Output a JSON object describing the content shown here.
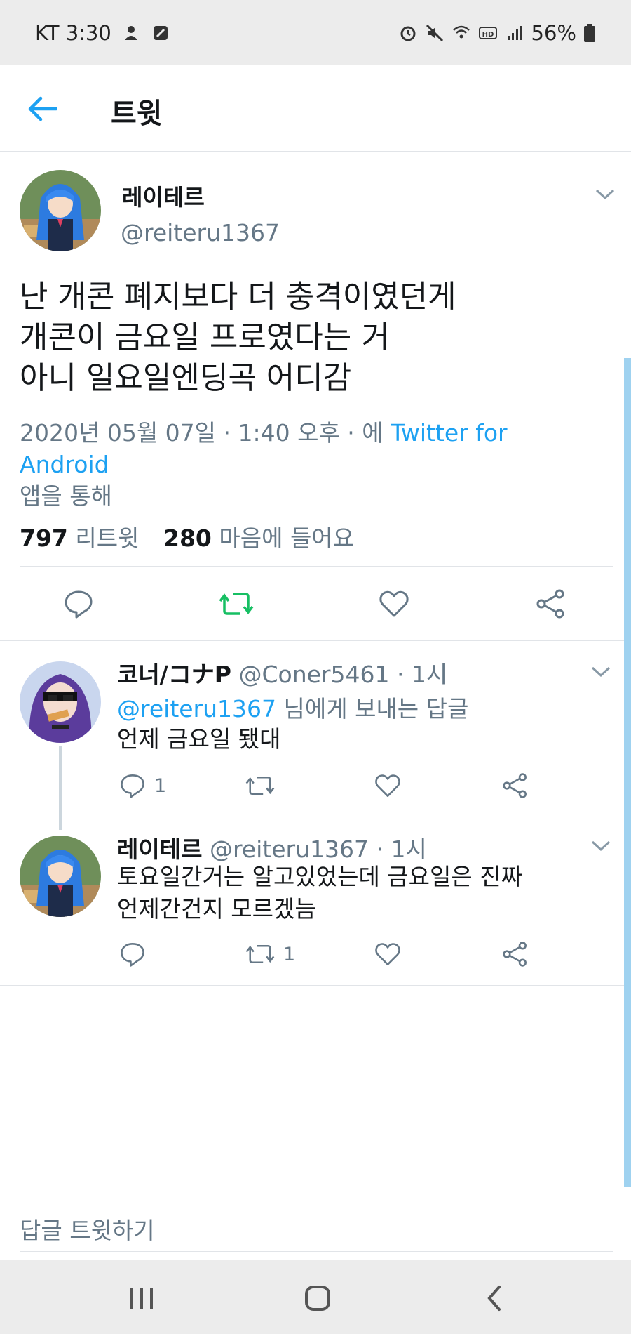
{
  "status_bar": {
    "carrier_time": "KT 3:30",
    "battery": "56%"
  },
  "header": {
    "title": "트윗"
  },
  "tweet": {
    "author_name": "레이테르",
    "author_handle": "@reiteru1367",
    "text_lines": [
      "난 개콘 폐지보다 더 충격이였던게",
      "개콘이 금요일 프로였다는 거",
      "아니 일요일엔딩곡 어디감"
    ],
    "timestamp": "2020년 05월 07일 · 1:40 오후 · 에 ",
    "source": "Twitter for Android",
    "source_suffix": "앱을 통해",
    "retweet_count": "797",
    "retweet_label": "리트윗",
    "like_count": "280",
    "like_label": "마음에 들어요"
  },
  "replies": [
    {
      "name": "코너/コナP",
      "handle_time": "@Coner5461 · 1시",
      "reply_to_mention": "@reiteru1367",
      "reply_to_suffix": " 님에게 보내는 답글",
      "text_lines": [
        "언제 금요일 됐대"
      ],
      "reply_count": "1",
      "retweet_count": ""
    },
    {
      "name": "레이테르",
      "handle_time": "@reiteru1367 · 1시",
      "text_lines": [
        "토요일간거는 알고있었는데 금요일은 진짜",
        "언제간건지 모르겠늠"
      ],
      "reply_count": "",
      "retweet_count": "1"
    }
  ],
  "compose": {
    "placeholder": "답글 트윗하기"
  },
  "colors": {
    "accent": "#1da1f2",
    "retweet_green": "#17bf63",
    "secondary_text": "#657786",
    "divider": "#e1e4e8"
  },
  "icons": {
    "back": "arrow-left-icon",
    "reply": "comment-bubble-icon",
    "retweet": "retweet-icon",
    "like": "heart-outline-icon",
    "share": "share-nodes-icon",
    "more": "chevron-down-icon"
  }
}
